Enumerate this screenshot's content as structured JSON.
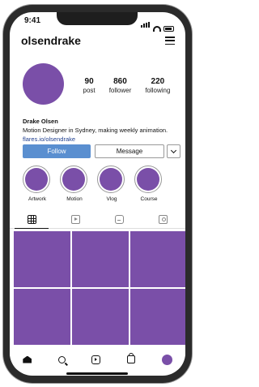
{
  "status": {
    "time": "9:41"
  },
  "profile": {
    "username": "olsendrake",
    "stats": [
      {
        "value": "90",
        "label": "post"
      },
      {
        "value": "860",
        "label": "follower"
      },
      {
        "value": "220",
        "label": "following"
      }
    ],
    "name": "Drake Olsen",
    "bio": "Motion Designer in Sydney, making weekly animation.",
    "link": "flares.io/olsendrake"
  },
  "actions": {
    "follow": "Follow",
    "message": "Message"
  },
  "highlights": [
    {
      "label": "Artwork"
    },
    {
      "label": "Motion"
    },
    {
      "label": "Vlog"
    },
    {
      "label": "Course"
    }
  ],
  "tabs": [
    {
      "icon": "grid-icon"
    },
    {
      "icon": "reels-icon"
    },
    {
      "icon": "igtv-icon"
    },
    {
      "icon": "tagged-icon"
    }
  ],
  "posts_count_visible": 6,
  "colors": {
    "accent": "#7a4fa8",
    "follow_button": "#5a8fd0"
  },
  "bottom_nav": [
    "home-icon",
    "search-icon",
    "reels-icon",
    "shop-icon",
    "profile-icon"
  ]
}
